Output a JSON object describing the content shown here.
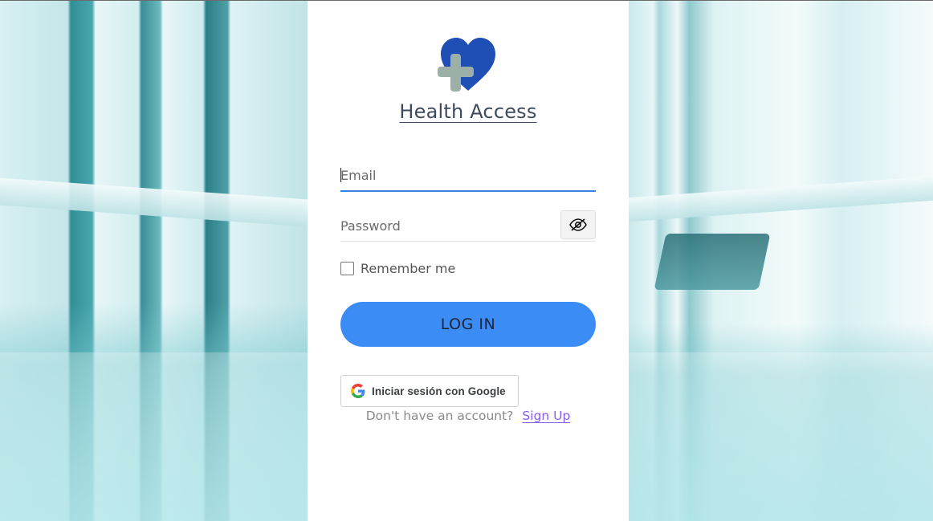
{
  "app": {
    "brand_name": "Health Access"
  },
  "login_form": {
    "email_placeholder": "Email",
    "email_value": "",
    "password_placeholder": "Password",
    "password_value": "",
    "toggle_password_icon": "eye-slash-icon",
    "remember_label": "Remember me",
    "remember_checked": false,
    "login_button_label": "LOG IN",
    "google_button_label": "Iniciar sesión con Google",
    "signup_prompt": "Don't have an account?",
    "signup_link_label": "Sign Up"
  },
  "colors": {
    "primary": "#3c8cf5",
    "logo_heart": "#1f4fb5",
    "logo_cross": "#9cb0a8",
    "link": "#8a5cf0",
    "focus_underline": "#3a7fe6"
  }
}
